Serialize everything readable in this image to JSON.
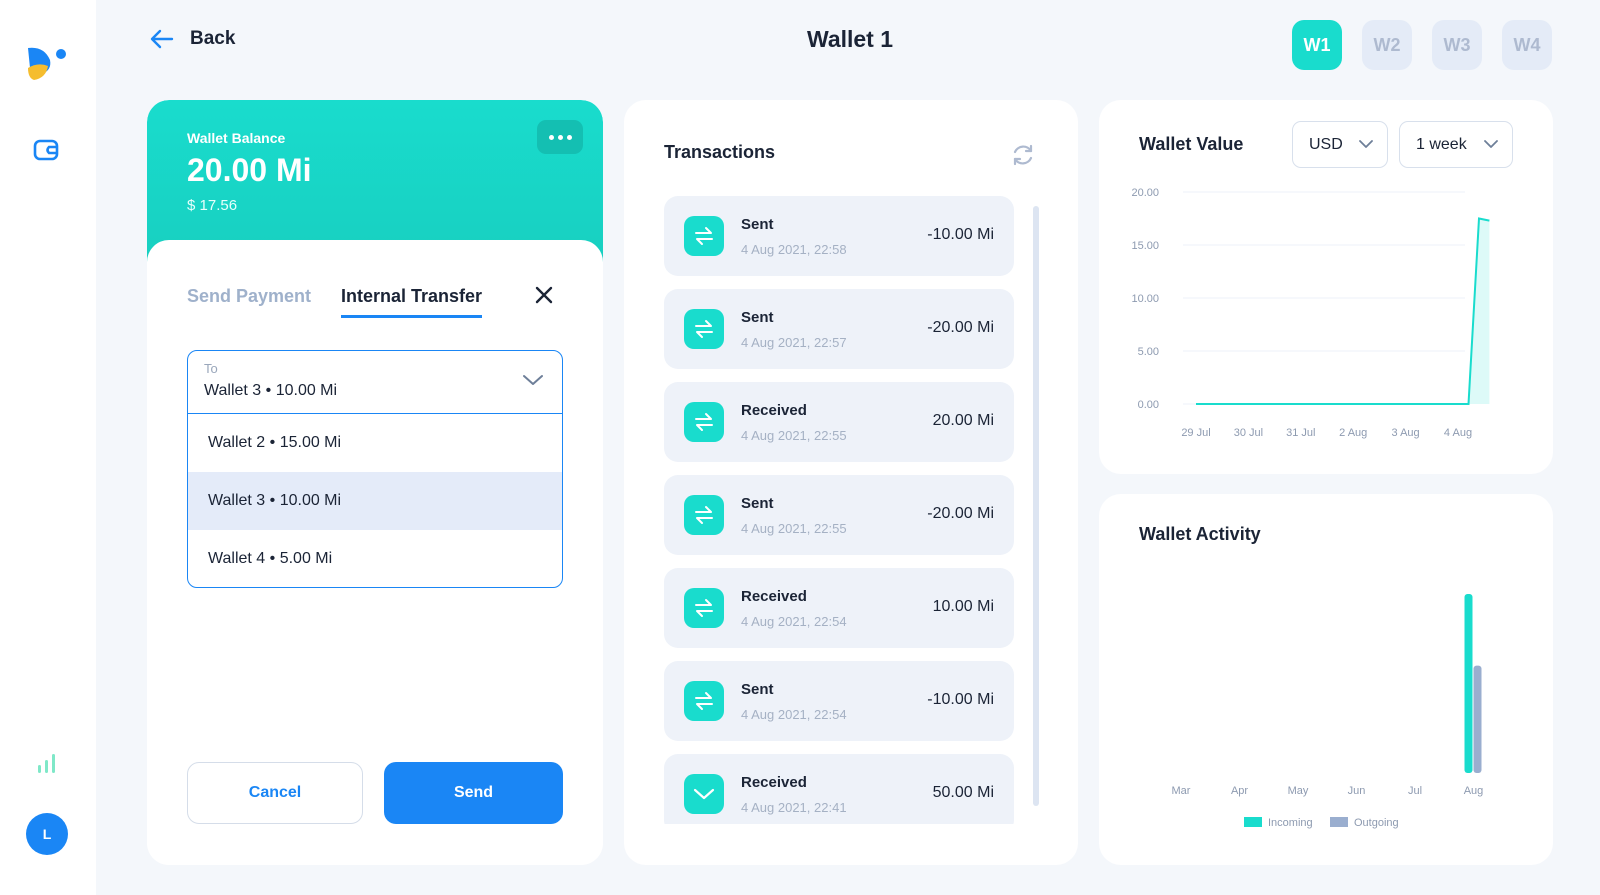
{
  "window": {
    "controls": [
      "close",
      "minimize",
      "maximize"
    ]
  },
  "sidebar": {
    "icons": [
      "logo-icon",
      "wallet-icon",
      "stats-icon"
    ],
    "avatar_initial": "L"
  },
  "header": {
    "back_label": "Back",
    "title": "Wallet 1",
    "wallet_tabs": [
      {
        "label": "W1",
        "active": true
      },
      {
        "label": "W2",
        "active": false
      },
      {
        "label": "W3",
        "active": false
      },
      {
        "label": "W4",
        "active": false
      }
    ]
  },
  "balance": {
    "label": "Wallet Balance",
    "amount": "20.00 Mi",
    "usd": "$ 17.56"
  },
  "transfer_form": {
    "tabs": [
      {
        "label": "Send Payment",
        "active": false
      },
      {
        "label": "Internal Transfer",
        "active": true
      }
    ],
    "to_label": "To",
    "to_value": "Wallet 3 • 10.00 Mi",
    "options": [
      {
        "label": "Wallet 2 • 15.00 Mi",
        "selected": false
      },
      {
        "label": "Wallet 3 • 10.00 Mi",
        "selected": true
      },
      {
        "label": "Wallet 4 • 5.00 Mi",
        "selected": false
      }
    ],
    "cancel_label": "Cancel",
    "send_label": "Send"
  },
  "transactions": {
    "title": "Transactions",
    "items": [
      {
        "type": "Sent",
        "date": "4 Aug 2021, 22:58",
        "amount": "-10.00 Mi",
        "icon": "transfer-icon"
      },
      {
        "type": "Sent",
        "date": "4 Aug 2021, 22:57",
        "amount": "-20.00 Mi",
        "icon": "transfer-icon"
      },
      {
        "type": "Received",
        "date": "4 Aug 2021, 22:55",
        "amount": "20.00 Mi",
        "icon": "transfer-icon"
      },
      {
        "type": "Sent",
        "date": "4 Aug 2021, 22:55",
        "amount": "-20.00 Mi",
        "icon": "transfer-icon"
      },
      {
        "type": "Received",
        "date": "4 Aug 2021, 22:54",
        "amount": "10.00 Mi",
        "icon": "transfer-icon"
      },
      {
        "type": "Sent",
        "date": "4 Aug 2021, 22:54",
        "amount": "-10.00 Mi",
        "icon": "transfer-icon"
      },
      {
        "type": "Received",
        "date": "4 Aug 2021, 22:41",
        "amount": "50.00 Mi",
        "icon": "chevron-down-icon"
      }
    ]
  },
  "wallet_value": {
    "title": "Wallet Value",
    "currency": "USD",
    "period": "1 week"
  },
  "wallet_activity": {
    "title": "Wallet Activity"
  },
  "colors": {
    "accent": "#19dccd",
    "primary": "#1a86f5",
    "outgoing": "#9aaecf"
  },
  "chart_data": [
    {
      "type": "area",
      "x": [
        "29 Jul",
        "30 Jul",
        "31 Jul",
        "2 Aug",
        "3 Aug",
        "4 Aug"
      ],
      "series": [
        {
          "points": [
            [
              0,
              0
            ],
            [
              1,
              0
            ],
            [
              2,
              0
            ],
            [
              3,
              0
            ],
            [
              4,
              0
            ],
            [
              5.2,
              0
            ],
            [
              5.4,
              17.5
            ],
            [
              5.6,
              17.3
            ]
          ]
        }
      ],
      "yticks": [
        "0.00",
        "5.00",
        "10.00",
        "15.00",
        "20.00"
      ],
      "ylim": [
        0,
        20
      ],
      "grid": true
    },
    {
      "type": "bar",
      "categories": [
        "Mar",
        "Apr",
        "May",
        "Jun",
        "Jul",
        "Aug"
      ],
      "series": [
        {
          "name": "Incoming",
          "values": [
            0,
            0,
            0,
            0,
            0,
            100
          ]
        },
        {
          "name": "Outgoing",
          "values": [
            0,
            0,
            0,
            0,
            0,
            60
          ]
        }
      ],
      "ylim": [
        0,
        100
      ],
      "legend": "bottom"
    }
  ]
}
